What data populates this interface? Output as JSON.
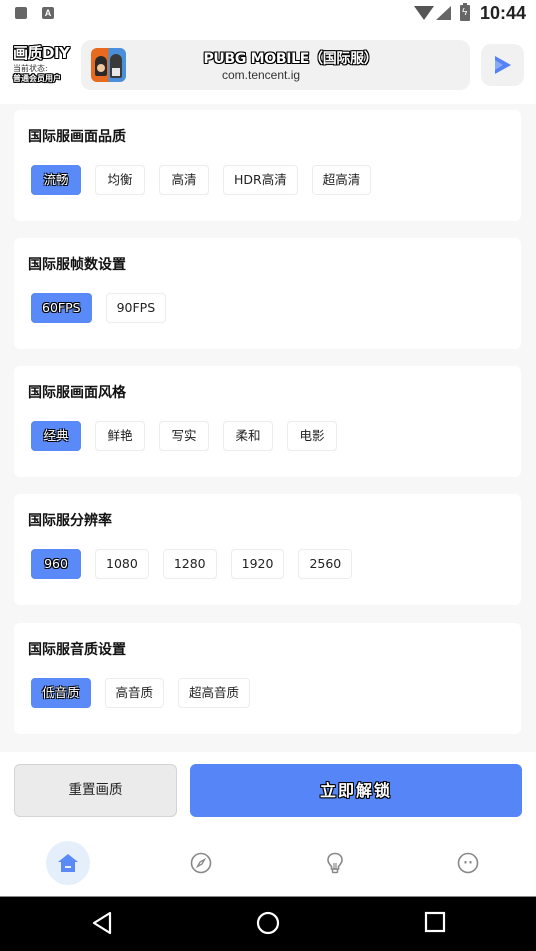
{
  "status_bar": {
    "left_icons": [
      "notification-icon",
      "keyboard-icon"
    ],
    "keyboard_glyph": "A",
    "right_icons": [
      "wifi-icon",
      "signal-icon",
      "battery-charging-icon"
    ],
    "battery_glyph": "ϟ",
    "time": "10:44"
  },
  "header": {
    "brand_title": "画质DIY",
    "status_label": "当前状态:",
    "status_value": "普通会员用户",
    "game": {
      "title": "PUBG MOBILE（国际服）",
      "package": "com.tencent.ig",
      "icon": "pubg-game-icon"
    },
    "launch_icon": "play-icon"
  },
  "sections": [
    {
      "title": "国际服画面品质",
      "options": [
        "流畅",
        "均衡",
        "高清",
        "HDR高清",
        "超高清"
      ],
      "selected": "流畅"
    },
    {
      "title": "国际服帧数设置",
      "options": [
        "60FPS",
        "90FPS"
      ],
      "selected": "60FPS"
    },
    {
      "title": "国际服画面风格",
      "options": [
        "经典",
        "鲜艳",
        "写实",
        "柔和",
        "电影"
      ],
      "selected": "经典"
    },
    {
      "title": "国际服分辨率",
      "options": [
        "960",
        "1080",
        "1280",
        "1920",
        "2560"
      ],
      "selected": "960"
    },
    {
      "title": "国际服音质设置",
      "options": [
        "低音质",
        "高音质",
        "超高音质"
      ],
      "selected": "低音质"
    }
  ],
  "actions": {
    "reset_label": "重置画质",
    "unlock_label": "立即解锁"
  },
  "bottom_nav": {
    "items": [
      {
        "name": "home",
        "icon": "home-icon",
        "active": true
      },
      {
        "name": "discover",
        "icon": "compass-icon",
        "active": false
      },
      {
        "name": "tips",
        "icon": "lightbulb-icon",
        "active": false
      },
      {
        "name": "profile",
        "icon": "face-icon",
        "active": false
      }
    ]
  },
  "system_nav": [
    "back-icon",
    "home-circle-icon",
    "recents-icon"
  ],
  "colors": {
    "accent": "#5a8af7",
    "active_nav_bg": "#e5effc",
    "chip_border": "#ececec",
    "page_bg": "#f7f7f7"
  }
}
